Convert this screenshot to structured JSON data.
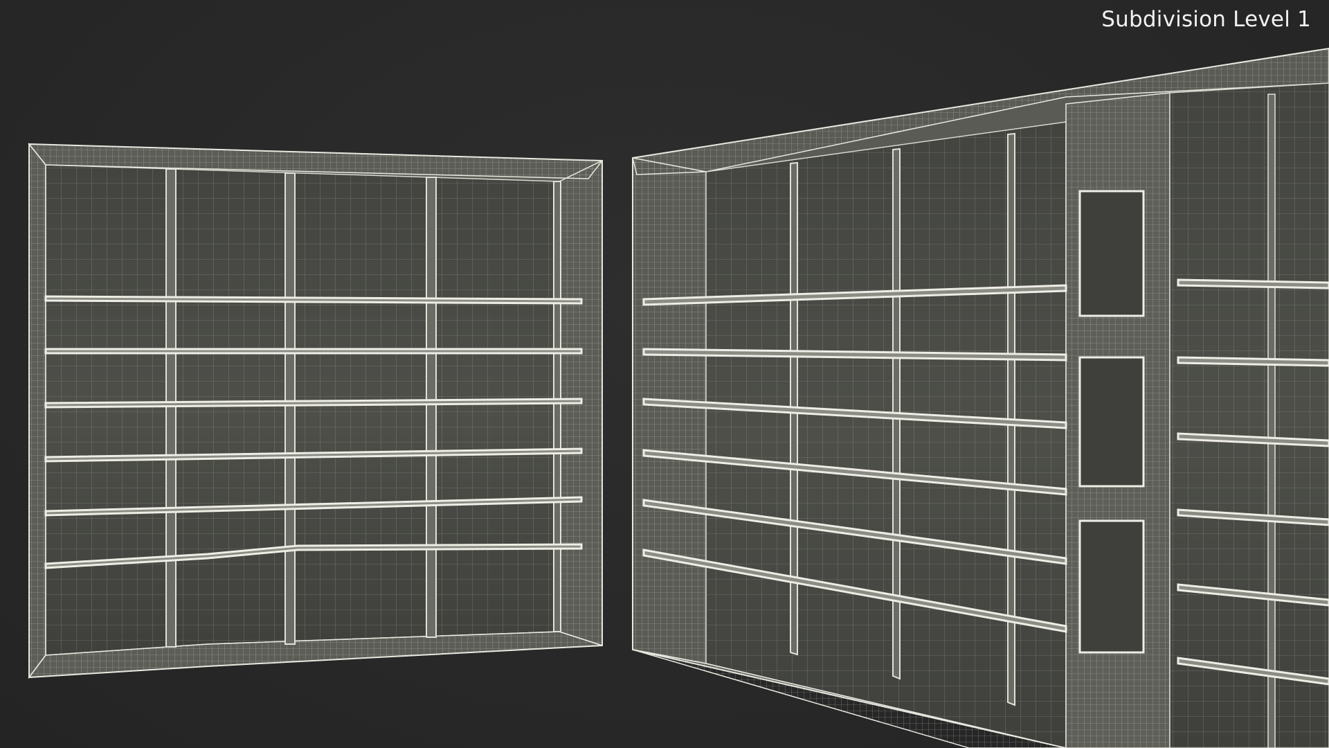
{
  "overlay": {
    "label": "Subdivision Level 1"
  },
  "scene": {
    "background_color": "#272727",
    "panel_color": "#4a4b46",
    "wire_color": "#e8e8e0",
    "objects": [
      {
        "name": "corner-bookshelf-wireframe"
      },
      {
        "name": "wall-bookshelf-wireframe"
      }
    ]
  }
}
